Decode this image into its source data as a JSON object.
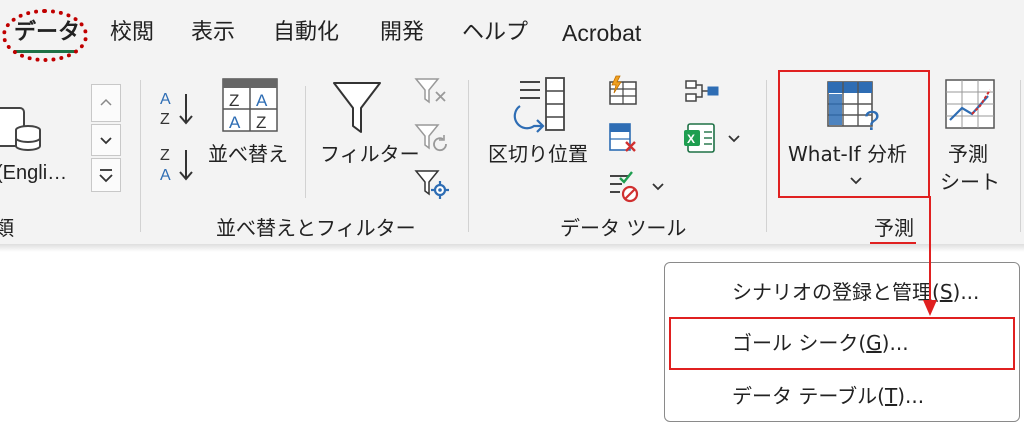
{
  "tabs": {
    "data": "データ",
    "review": "校閲",
    "view": "表示",
    "automate": "自動化",
    "developer": "開発",
    "help": "ヘルプ",
    "acrobat": "Acrobat"
  },
  "ribbon": {
    "left_group": {
      "button_label": "(Engli…",
      "group_label_fragment": "類"
    },
    "sort_filter": {
      "sort_button": "並べ替え",
      "filter_button": "フィルター",
      "group_label": "並べ替えとフィルター"
    },
    "data_tools": {
      "text_to_columns": "区切り位置",
      "group_label": "データ ツール"
    },
    "forecast": {
      "whatif_button": "What-If 分析",
      "forecast_sheet_line1": "予測",
      "forecast_sheet_line2": "シート",
      "group_label": "予測"
    }
  },
  "whatif_menu": {
    "scenario_text": "シナリオの登録と管理(",
    "scenario_key": "S",
    "scenario_tail": ")...",
    "goal_text": "ゴール シーク(",
    "goal_key": "G",
    "goal_tail": ")...",
    "table_text": "データ テーブル(",
    "table_key": "T",
    "table_tail": ")..."
  },
  "colors": {
    "accent_green": "#1e7145",
    "annotation_red": "#e02020",
    "icon_blue": "#2e6db4"
  }
}
